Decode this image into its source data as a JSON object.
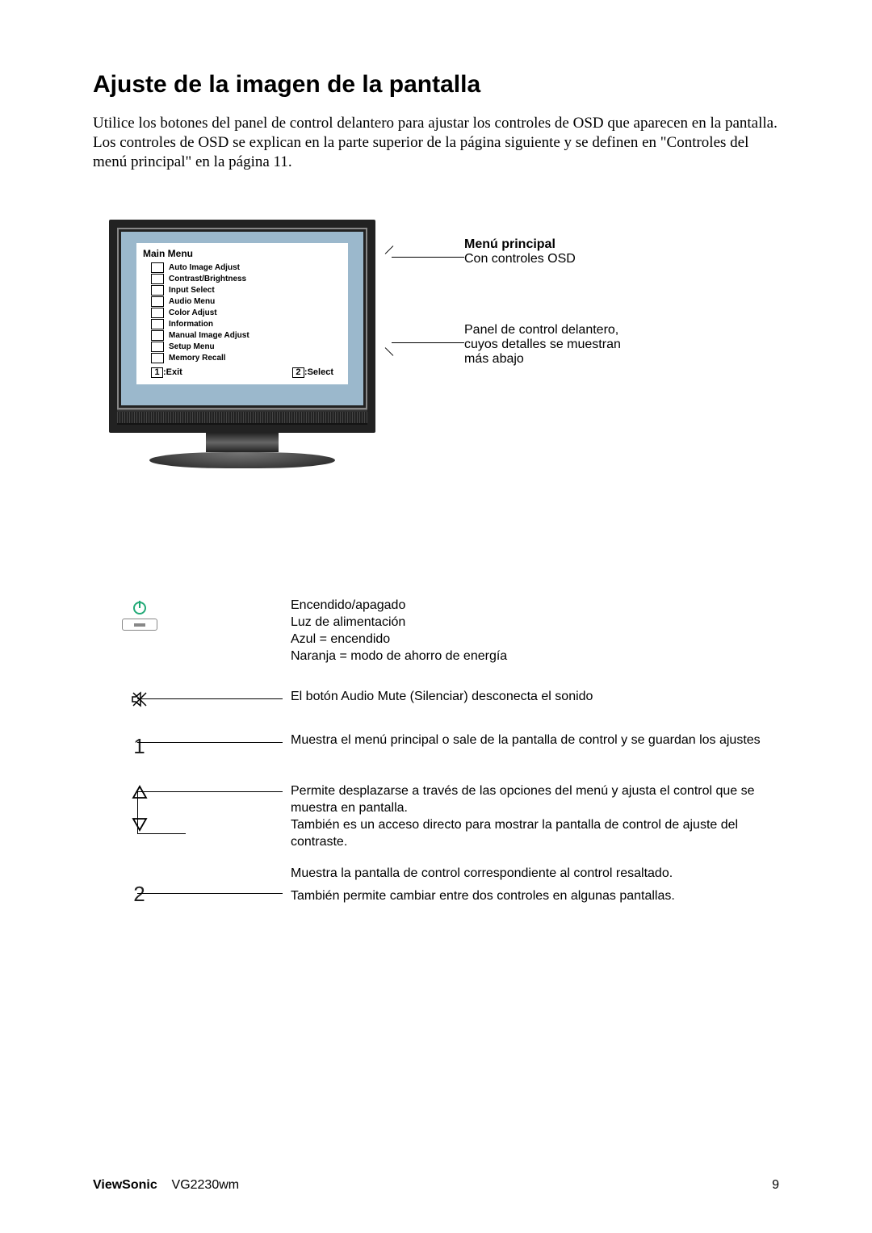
{
  "heading": "Ajuste de la imagen de la pantalla",
  "intro": "Utilice los botones del panel de control delantero para ajustar los controles de OSD que aparecen en la pantalla. Los controles de OSD se explican en la parte superior de la página siguiente y se definen en \"Controles del menú principal\" en la página 11.",
  "osd": {
    "title": "Main Menu",
    "items": [
      "Auto Image Adjust",
      "Contrast/Brightness",
      "Input Select",
      "Audio Menu",
      "Color Adjust",
      "Information",
      "Manual Image Adjust",
      "Setup Menu",
      "Memory Recall"
    ],
    "exit_key": "1",
    "exit_label": ":Exit",
    "select_key": "2",
    "select_label": ":Select"
  },
  "callout1": {
    "title": "Menú principal",
    "text": "Con controles OSD"
  },
  "callout2": {
    "line1": "Panel de control delantero,",
    "line2": "cuyos detalles se muestran",
    "line3": "más abajo"
  },
  "controls": {
    "power": {
      "l1": "Encendido/apagado",
      "l2": "Luz de alimentación",
      "l3": "Azul = encendido",
      "l4": "Naranja = modo de ahorro de energía"
    },
    "mute": "El botón Audio Mute (Silenciar) desconecta el sonido",
    "btn1": "Muestra el menú principal o sale de la pantalla de control y se guardan los ajustes",
    "arrows": {
      "l1": "Permite desplazarse a través de las opciones del menú y ajusta el control que se muestra en pantalla.",
      "l2": "También es un acceso directo para mostrar la pantalla de control de ajuste del contraste."
    },
    "btn2": {
      "l1": "Muestra la pantalla de control correspondiente al control resaltado.",
      "l2": "También permite cambiar entre dos controles en algunas pantallas."
    }
  },
  "footer": {
    "brand": "ViewSonic",
    "model": "VG2230wm",
    "page": "9"
  }
}
